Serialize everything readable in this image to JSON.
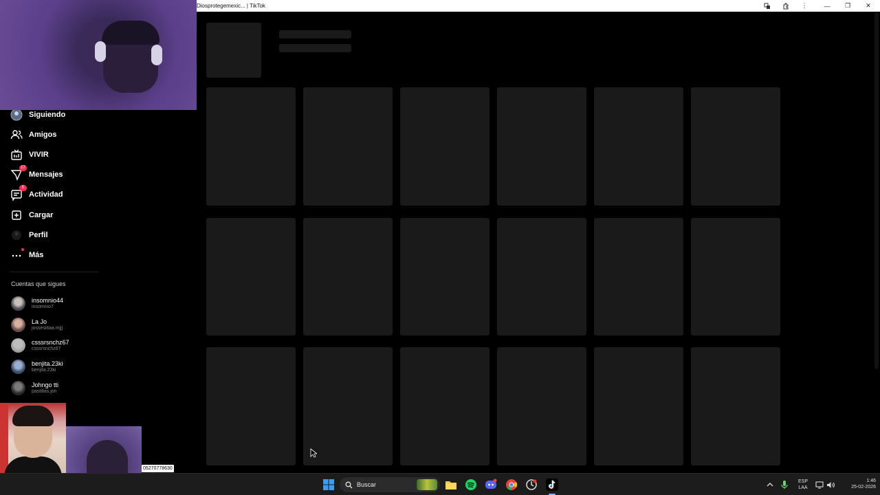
{
  "window": {
    "title": "Diosprotegemexic... | TikTok"
  },
  "sidebar": {
    "nav": [
      {
        "label": "Siguiendo",
        "icon": "following-avatar-icon"
      },
      {
        "label": "Amigos",
        "icon": "friends-icon"
      },
      {
        "label": "VIVIR",
        "icon": "live-tv-icon"
      },
      {
        "label": "Mensajes",
        "icon": "messages-icon",
        "badge": "17"
      },
      {
        "label": "Actividad",
        "icon": "activity-icon",
        "badge": "5"
      },
      {
        "label": "Cargar",
        "icon": "upload-icon"
      },
      {
        "label": "Perfil",
        "icon": "profile-avatar-icon"
      },
      {
        "label": "Más",
        "icon": "more-icon"
      }
    ],
    "following_title": "Cuentas que sigues",
    "accounts": [
      {
        "name": "insomnio44",
        "handle": "insomnio7"
      },
      {
        "name": "La Jo",
        "handle": "jossesiitaa.mjjj"
      },
      {
        "name": "csssrsnchz67",
        "handle": "csssrsnchz67"
      },
      {
        "name": "benjita.23ki",
        "handle": "benjita.23ki"
      },
      {
        "name": "Johngo tti",
        "handle": "pastillas.jon"
      }
    ]
  },
  "overlay": {
    "cam_label": "05270778630"
  },
  "taskbar": {
    "search_label": "Buscar",
    "lang_top": "ESP",
    "lang_bottom": "LAA",
    "time": "1:46",
    "date": "25-02-2026"
  },
  "colors": {
    "badge": "#fe2c55",
    "skeleton": "#1a1a1a",
    "taskbar": "#1c1c1c"
  }
}
